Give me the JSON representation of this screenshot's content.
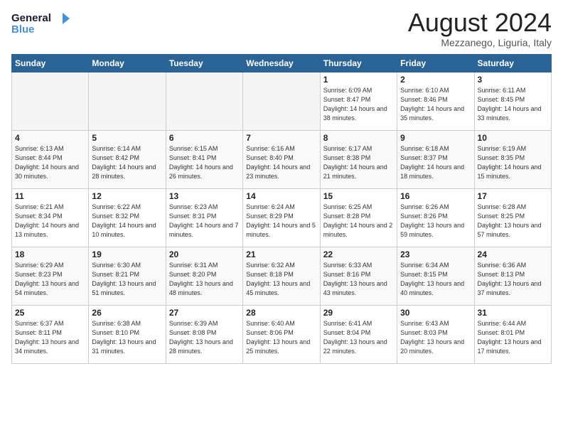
{
  "header": {
    "logo_general": "General",
    "logo_blue": "Blue",
    "month_title": "August 2024",
    "location": "Mezzanego, Liguria, Italy"
  },
  "weekdays": [
    "Sunday",
    "Monday",
    "Tuesday",
    "Wednesday",
    "Thursday",
    "Friday",
    "Saturday"
  ],
  "weeks": [
    [
      {
        "day": "",
        "empty": true
      },
      {
        "day": "",
        "empty": true
      },
      {
        "day": "",
        "empty": true
      },
      {
        "day": "",
        "empty": true
      },
      {
        "day": "1",
        "sunrise": "6:09 AM",
        "sunset": "8:47 PM",
        "daylight": "14 hours and 38 minutes."
      },
      {
        "day": "2",
        "sunrise": "6:10 AM",
        "sunset": "8:46 PM",
        "daylight": "14 hours and 35 minutes."
      },
      {
        "day": "3",
        "sunrise": "6:11 AM",
        "sunset": "8:45 PM",
        "daylight": "14 hours and 33 minutes."
      }
    ],
    [
      {
        "day": "4",
        "sunrise": "6:13 AM",
        "sunset": "8:44 PM",
        "daylight": "14 hours and 30 minutes."
      },
      {
        "day": "5",
        "sunrise": "6:14 AM",
        "sunset": "8:42 PM",
        "daylight": "14 hours and 28 minutes."
      },
      {
        "day": "6",
        "sunrise": "6:15 AM",
        "sunset": "8:41 PM",
        "daylight": "14 hours and 26 minutes."
      },
      {
        "day": "7",
        "sunrise": "6:16 AM",
        "sunset": "8:40 PM",
        "daylight": "14 hours and 23 minutes."
      },
      {
        "day": "8",
        "sunrise": "6:17 AM",
        "sunset": "8:38 PM",
        "daylight": "14 hours and 21 minutes."
      },
      {
        "day": "9",
        "sunrise": "6:18 AM",
        "sunset": "8:37 PM",
        "daylight": "14 hours and 18 minutes."
      },
      {
        "day": "10",
        "sunrise": "6:19 AM",
        "sunset": "8:35 PM",
        "daylight": "14 hours and 15 minutes."
      }
    ],
    [
      {
        "day": "11",
        "sunrise": "6:21 AM",
        "sunset": "8:34 PM",
        "daylight": "14 hours and 13 minutes."
      },
      {
        "day": "12",
        "sunrise": "6:22 AM",
        "sunset": "8:32 PM",
        "daylight": "14 hours and 10 minutes."
      },
      {
        "day": "13",
        "sunrise": "6:23 AM",
        "sunset": "8:31 PM",
        "daylight": "14 hours and 7 minutes."
      },
      {
        "day": "14",
        "sunrise": "6:24 AM",
        "sunset": "8:29 PM",
        "daylight": "14 hours and 5 minutes."
      },
      {
        "day": "15",
        "sunrise": "6:25 AM",
        "sunset": "8:28 PM",
        "daylight": "14 hours and 2 minutes."
      },
      {
        "day": "16",
        "sunrise": "6:26 AM",
        "sunset": "8:26 PM",
        "daylight": "13 hours and 59 minutes."
      },
      {
        "day": "17",
        "sunrise": "6:28 AM",
        "sunset": "8:25 PM",
        "daylight": "13 hours and 57 minutes."
      }
    ],
    [
      {
        "day": "18",
        "sunrise": "6:29 AM",
        "sunset": "8:23 PM",
        "daylight": "13 hours and 54 minutes."
      },
      {
        "day": "19",
        "sunrise": "6:30 AM",
        "sunset": "8:21 PM",
        "daylight": "13 hours and 51 minutes."
      },
      {
        "day": "20",
        "sunrise": "6:31 AM",
        "sunset": "8:20 PM",
        "daylight": "13 hours and 48 minutes."
      },
      {
        "day": "21",
        "sunrise": "6:32 AM",
        "sunset": "8:18 PM",
        "daylight": "13 hours and 45 minutes."
      },
      {
        "day": "22",
        "sunrise": "6:33 AM",
        "sunset": "8:16 PM",
        "daylight": "13 hours and 43 minutes."
      },
      {
        "day": "23",
        "sunrise": "6:34 AM",
        "sunset": "8:15 PM",
        "daylight": "13 hours and 40 minutes."
      },
      {
        "day": "24",
        "sunrise": "6:36 AM",
        "sunset": "8:13 PM",
        "daylight": "13 hours and 37 minutes."
      }
    ],
    [
      {
        "day": "25",
        "sunrise": "6:37 AM",
        "sunset": "8:11 PM",
        "daylight": "13 hours and 34 minutes."
      },
      {
        "day": "26",
        "sunrise": "6:38 AM",
        "sunset": "8:10 PM",
        "daylight": "13 hours and 31 minutes."
      },
      {
        "day": "27",
        "sunrise": "6:39 AM",
        "sunset": "8:08 PM",
        "daylight": "13 hours and 28 minutes."
      },
      {
        "day": "28",
        "sunrise": "6:40 AM",
        "sunset": "8:06 PM",
        "daylight": "13 hours and 25 minutes."
      },
      {
        "day": "29",
        "sunrise": "6:41 AM",
        "sunset": "8:04 PM",
        "daylight": "13 hours and 22 minutes."
      },
      {
        "day": "30",
        "sunrise": "6:43 AM",
        "sunset": "8:03 PM",
        "daylight": "13 hours and 20 minutes."
      },
      {
        "day": "31",
        "sunrise": "6:44 AM",
        "sunset": "8:01 PM",
        "daylight": "13 hours and 17 minutes."
      }
    ]
  ]
}
